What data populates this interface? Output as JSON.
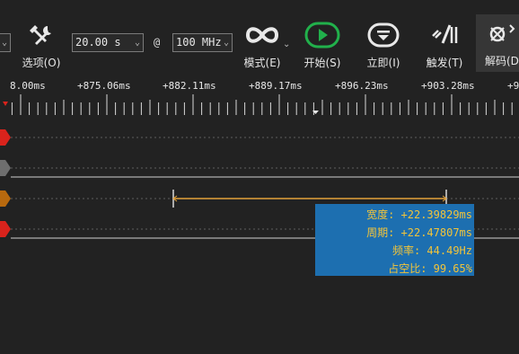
{
  "toolbar": {
    "options_label": "选项(O)",
    "duration_value": "20.00 s",
    "at_symbol": "@",
    "rate_value": "100 MHz",
    "mode_label": "模式(E)",
    "start_label": "开始(S)",
    "immediate_label": "立即(I)",
    "trigger_label": "触发(T)",
    "decode_label": "解码(D"
  },
  "ruler": {
    "labels": [
      "8.00ms",
      "+875.06ms",
      "+882.11ms",
      "+889.17ms",
      "+896.23ms",
      "+903.28ms",
      "+9"
    ]
  },
  "measurement": {
    "width": "宽度: +22.39829ms",
    "period": "周期: +22.47807ms",
    "frequency": "频率: 44.49Hz",
    "duty": "占空比: 99.65%"
  },
  "colors": {
    "background": "#222222",
    "channel_red": "#d9231c",
    "channel_gray": "#6e6e6e",
    "channel_brown": "#b8690e",
    "measure_bg": "#1d6fb0",
    "measure_text": "#f2c43a",
    "cursor_line": "#e3a23a",
    "start_green": "#21b04b"
  }
}
